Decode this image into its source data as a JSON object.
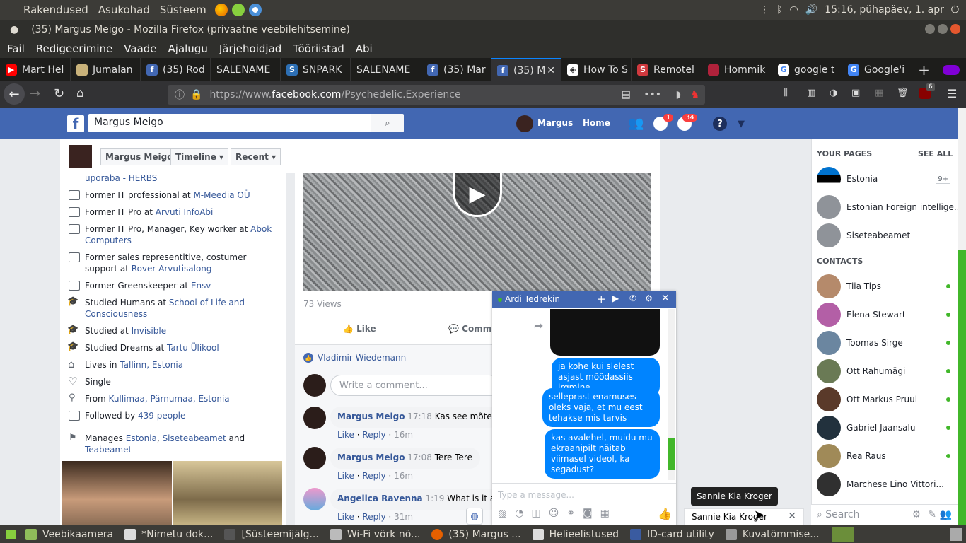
{
  "system": {
    "menus": [
      "Rakendused",
      "Asukohad",
      "Süsteem"
    ],
    "clock": "15:16, pühapäev,  1. apr"
  },
  "window": {
    "title": "(35) Margus Meigo - Mozilla Firefox (privaatne veebilehitsemine)"
  },
  "menubar": [
    "Fail",
    "Redigeerimine",
    "Vaade",
    "Ajalugu",
    "Järjehoidjad",
    "Tööriistad",
    "Abi"
  ],
  "tabs": [
    {
      "label": "Mart Hel",
      "color": "#ff0000"
    },
    {
      "label": "Jumalan",
      "color": "#c9b27a"
    },
    {
      "label": "(35) Rod",
      "color": "#4267b2"
    },
    {
      "label": "SALENAME",
      "color": ""
    },
    {
      "label": "SNPARK",
      "color": "#2d6fb4"
    },
    {
      "label": "SALENAME",
      "color": ""
    },
    {
      "label": "(35) Mar",
      "color": "#4267b2"
    },
    {
      "label": "(35) M",
      "color": "#4267b2"
    },
    {
      "label": "How To S",
      "color": "#ffffff"
    },
    {
      "label": "Remotel",
      "color": "#d0393e"
    },
    {
      "label": "Hommik",
      "color": "#b0223b"
    },
    {
      "label": "google t",
      "color": "#ffffff"
    },
    {
      "label": "Google'i",
      "color": "#4285f4"
    }
  ],
  "nav": {
    "url_prefix": "https://www.",
    "url_domain": "facebook.com",
    "url_path": "/Psychedelic.Experience",
    "badge": "6"
  },
  "fb": {
    "search_value": "Margus Meigo",
    "user": "Margus",
    "home": "Home",
    "msg_badge": "1",
    "notif_badge": "34",
    "timeline_name": "Margus Meigo",
    "timeline_btn": "Timeline",
    "recent_btn": "Recent"
  },
  "intro": [
    {
      "text": "",
      "link": "uporaba - HERBS",
      "after": ""
    },
    {
      "text": "Former IT professional at ",
      "link": "M-Meedia OÜ",
      "after": ""
    },
    {
      "text": "Former IT Pro at ",
      "link": "Arvuti InfoAbi",
      "after": ""
    },
    {
      "text": "Former IT Pro, Manager, Key worker at ",
      "link": "Abok Computers",
      "after": ""
    },
    {
      "text": "Former sales representitive, costumer support at ",
      "link": "Rover Arvutisalong",
      "after": ""
    },
    {
      "text": "Former Greenskeeper at ",
      "link": "Ensv",
      "after": ""
    },
    {
      "text": "Studied Humans at ",
      "link": "School of Life and Consciousness",
      "after": ""
    },
    {
      "text": "Studied at ",
      "link": "Invisible",
      "after": ""
    },
    {
      "text": "Studied Dreams at ",
      "link": "Tartu Ülikool",
      "after": ""
    },
    {
      "text": "Lives in ",
      "link": "Tallinn, Estonia",
      "after": ""
    },
    {
      "text": "Single",
      "link": "",
      "after": ""
    },
    {
      "text": "From ",
      "link": "Kullimaa, Pärnumaa, Estonia",
      "after": ""
    },
    {
      "text": "Followed by ",
      "link": "439 people",
      "after": ""
    },
    {
      "text": "Manages ",
      "link": "Estonia",
      "after": ", "
    },
    {
      "text": "",
      "link": "Siseteabeamet",
      "after": " and "
    },
    {
      "text": "",
      "link": "Teabeamet",
      "after": ""
    }
  ],
  "post": {
    "views": "73 Views",
    "like": "Like",
    "comment": "Comm",
    "liker": "Vladimir Wiedemann",
    "comment_placeholder": "Write a comment..."
  },
  "comments": [
    {
      "name": "Margus Meigo",
      "time": "17:18",
      "text": "Kas see mõte",
      "age": "16m"
    },
    {
      "name": "Margus Meigo",
      "time": "17:08",
      "text": "Tere Tere",
      "age": "16m"
    },
    {
      "name": "Angelica Ravenna",
      "time": "1:19",
      "text": "What is it a",
      "age": "31m"
    }
  ],
  "comment_actions": {
    "like": "Like",
    "reply": "Reply"
  },
  "chat": {
    "name": "Ardi Tedrekin",
    "messages": [
      "ja kohe kui slelest asjast mõõdassiis jrgmine",
      "selleprast enamuses oleks vaja, et mu eest tehakse mis tarvis",
      "kas avalehel, muidu mu ekraanipilt näitab viimasel videol, ka segadust?"
    ],
    "placeholder": "Type a message..."
  },
  "tooltip": "Sannie Kia Kroger",
  "chatbar_name": "Sannie Kia Kroger",
  "sidebar": {
    "pages_title": "YOUR PAGES",
    "see_all": "SEE ALL",
    "pages": [
      {
        "name": "Estonia",
        "badge": "9+"
      },
      {
        "name": "Estonian Foreign intellige...",
        "badge": ""
      },
      {
        "name": "Siseteabeamet",
        "badge": ""
      }
    ],
    "contacts_title": "CONTACTS",
    "contacts": [
      "Tiia Tips",
      "Elena Stewart",
      "Toomas Sirge",
      "Ott Rahumägi",
      "Ott Markus Pruul",
      "Gabriel Jaansalu",
      "Rea Raus",
      "Marchese Lino Vittori..."
    ],
    "search": "Search"
  },
  "taskbar": [
    "Veebikaamera",
    "*Nimetu dok...",
    "[Süsteemijälg...",
    "Wi-Fi võrk nõ...",
    "(35) Margus ...",
    "Helieelistused",
    "ID-card utility",
    "Kuvatõmmise..."
  ]
}
